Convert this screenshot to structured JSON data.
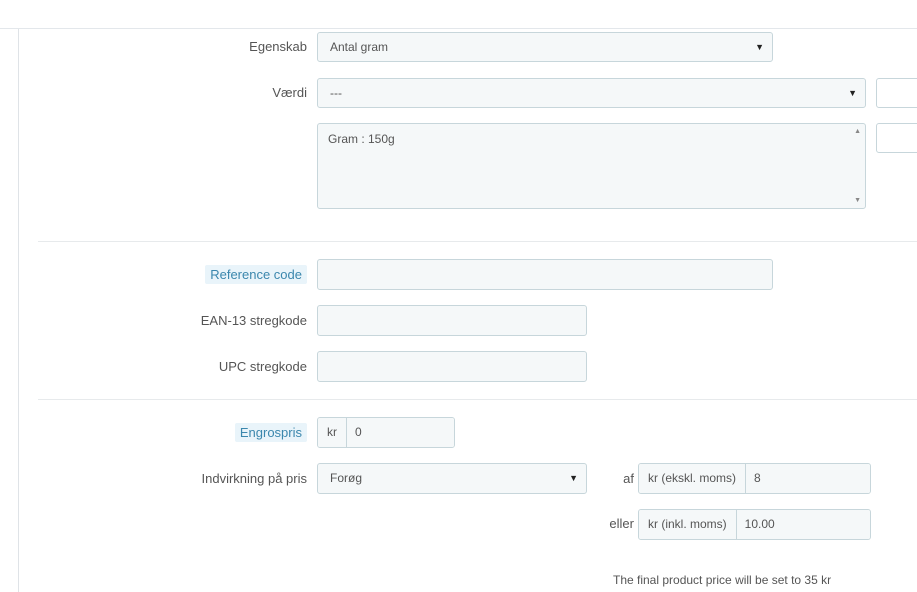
{
  "form": {
    "attribute": {
      "label": "Egenskab",
      "selected": "Antal gram"
    },
    "value": {
      "label": "Værdi",
      "selected": "---"
    },
    "combination_list": {
      "content": "Gram : 150g"
    },
    "reference": {
      "label": "Reference code",
      "value": ""
    },
    "ean13": {
      "label": "EAN-13 stregkode",
      "value": ""
    },
    "upc": {
      "label": "UPC stregkode",
      "value": ""
    },
    "wholesale": {
      "label": "Engrospris",
      "currency": "kr",
      "value": "0"
    },
    "impact": {
      "label": "Indvirkning på pris",
      "selected": "Forøg",
      "of_label": "af",
      "excl_addon": "kr (ekskl. moms)",
      "excl_value": "8",
      "or_label": "eller",
      "incl_addon": "kr (inkl. moms)",
      "incl_value": "10.00"
    },
    "final_price_note": "The final product price will be set to 35 kr"
  },
  "icons": {
    "select_caret": "caret-down-icon",
    "scroll_up": "scroll-up-icon",
    "scroll_down": "scroll-down-icon"
  }
}
